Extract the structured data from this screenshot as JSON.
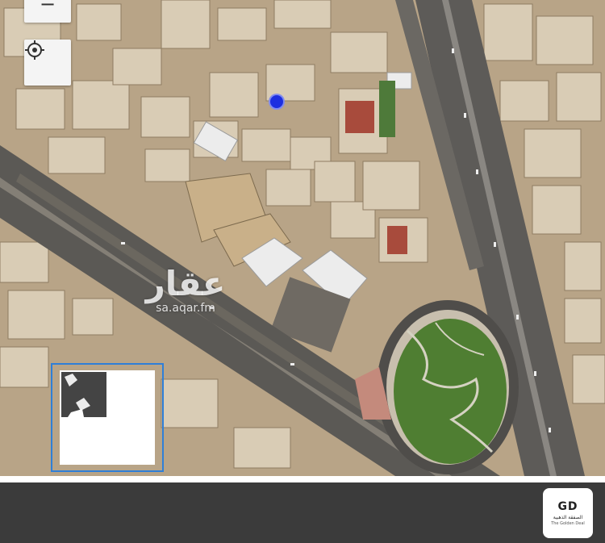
{
  "map": {
    "watermark_logo": "عقار",
    "watermark_url": "sa.aqar.fm",
    "zoom_out_symbol": "−",
    "zoom_out_icon": "minus-icon",
    "locate_icon": "crosshair-icon",
    "thumbnail_icon": "parcel-shape-icon",
    "location_dot_color": "#1d2fe0"
  },
  "footer": {
    "brand_mark": "GD",
    "brand_arabic": "الصفقة الذهبية",
    "brand_english": "The Golden Deal"
  }
}
